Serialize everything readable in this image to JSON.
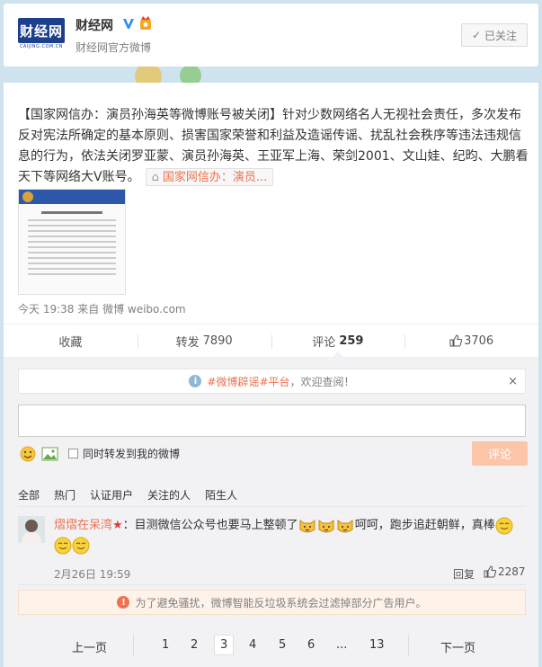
{
  "profile": {
    "logo_text": "财经网",
    "logo_sub": "CAIJING.COM.CN",
    "name": "财经网",
    "description": "财经网官方微博",
    "follow_label": "已关注"
  },
  "post": {
    "text": "【国家网信办：演员孙海英等微博账号被关闭】针对少数网络名人无视社会责任，多次发布反对宪法所确定的基本原则、损害国家荣誉和利益及造谣传谣、扰乱社会秩序等违法违规信息的行为，依法关闭罗亚蒙、演员孙海英、王亚军上海、荣剑2001、文山娃、纪昀、大鹏看天下等网络大V账号。",
    "link_label": "国家网信办：演员...",
    "time": "今天 19:38",
    "source_prefix": "来自",
    "source": "微博 weibo.com"
  },
  "actions": {
    "collect": "收藏",
    "repost_label": "转发",
    "repost_count": "7890",
    "comment_label": "评论",
    "comment_count": "259",
    "like_count": "3706"
  },
  "comment_box": {
    "notice_hashtag": "#微博辟谣#平台",
    "notice_rest": "，欢迎查阅！",
    "notice_close": "×",
    "repost_option": "同时转发到我的微博",
    "submit_label": "评论"
  },
  "filters": [
    "全部",
    "热门",
    "认证用户",
    "关注的人",
    "陌生人"
  ],
  "comment": {
    "user": "熠熠在呆湾",
    "star": "★",
    "text_before": "：目测微信公众号也要马上整顿了",
    "text_after": "呵呵，跑步追赶朝鲜，真棒",
    "time": "2月26日 19:59",
    "reply_label": "回复",
    "like_count": "2287"
  },
  "spam_notice": "为了避免骚扰，微博智能反垃圾系统会过滤掉部分广告用户。",
  "pagination": {
    "prev": "上一页",
    "pages": [
      "1",
      "2",
      "3",
      "4",
      "5",
      "6",
      "...",
      "13"
    ],
    "current": "3",
    "next": "下一页"
  },
  "colors": {
    "accent": "#eb7350",
    "logo_blue": "#1e3f8c",
    "submit_disabled": "#fcc5a8",
    "comment_bg": "#f2f2f5"
  },
  "icons": [
    "verified-v-icon",
    "vip-badge-icon",
    "link-icon",
    "thumb-up-icon",
    "info-icon",
    "close-icon",
    "emoji-icon",
    "picture-icon",
    "cat-emoji-icon",
    "smile-emoji-icon",
    "warning-icon"
  ]
}
